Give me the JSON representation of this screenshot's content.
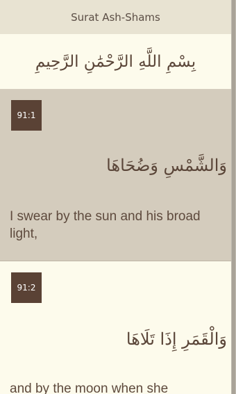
{
  "header": {
    "title": "Surat Ash-Shams"
  },
  "basmala": "بِسْمِ اللَّهِ الرَّحْمَٰنِ الرَّحِيمِ",
  "verses": [
    {
      "number": "91:1",
      "arabic": "وَالشَّمْسِ وَضُحَاهَا",
      "translation": "I swear by the sun and his broad light,"
    },
    {
      "number": "91:2",
      "arabic": "وَالْقَمَرِ إِذَا تَلَاهَا",
      "translation": "and by the moon when she"
    }
  ],
  "colors": {
    "title_bar": "#e8e3d2",
    "selected_row": "#d4ccbd",
    "badge": "#5a4235",
    "background": "#fdfbec",
    "text": "#5e4a3d"
  }
}
